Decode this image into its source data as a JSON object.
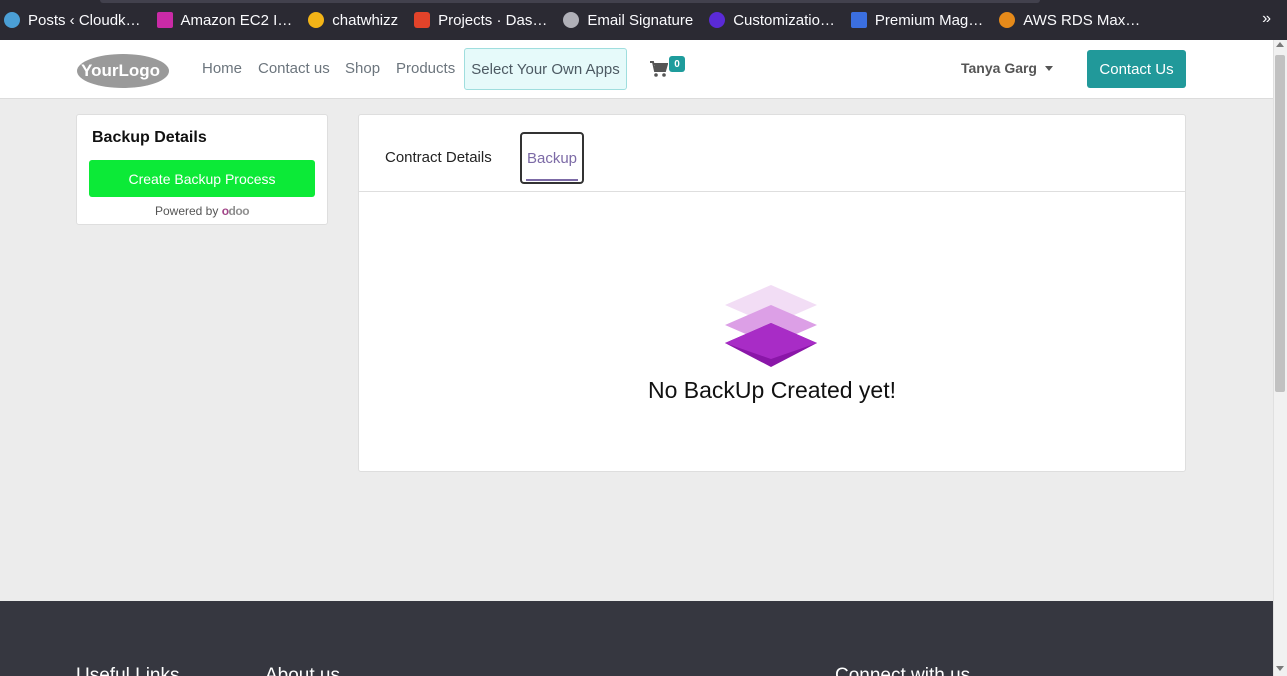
{
  "bookmarks": {
    "items": [
      {
        "label": "Posts ‹ Cloudk…",
        "icon": "wordpress-icon",
        "color": "#4b9fd6"
      },
      {
        "label": "Amazon EC2 I…",
        "icon": "ec2-icon",
        "color": "#c92aa6"
      },
      {
        "label": "chatwhizz",
        "icon": "chatwhizz-icon",
        "color": "#f3b417"
      },
      {
        "label": "Projects · Das…",
        "icon": "gitlab-icon",
        "color": "#e2432a"
      },
      {
        "label": "Email Signature",
        "icon": "globe-icon",
        "color": "#b0b0b8"
      },
      {
        "label": "Customizatio…",
        "icon": "customization-icon",
        "color": "#5a2ad6"
      },
      {
        "label": "Premium Mag…",
        "icon": "magento-icon",
        "color": "#3b6fe0"
      },
      {
        "label": "AWS RDS Max…",
        "icon": "aws-gear-icon",
        "color": "#e68a1a"
      }
    ],
    "more": "»"
  },
  "navbar": {
    "logo_text": "YourLogo",
    "links": [
      "Home",
      "Contact us",
      "Shop",
      "Products"
    ],
    "apps_button": "Select Your Own Apps",
    "cart_count": "0",
    "user_name": "Tanya Garg",
    "contact_button": "Contact Us"
  },
  "sidebar": {
    "title": "Backup Details",
    "create_button": "Create Backup Process",
    "powered_by": "Powered by",
    "odoo_first": "o",
    "odoo_rest": "doo"
  },
  "main": {
    "tabs": [
      {
        "label": "Contract Details",
        "active": false
      },
      {
        "label": "Backup",
        "active": true
      }
    ],
    "empty_message": "No BackUp Created yet!"
  },
  "footer": {
    "headings": [
      "Useful Links",
      "About us",
      "Connect with us"
    ]
  },
  "colors": {
    "accent": "#21999a",
    "create_button": "#0cea37",
    "active_tab": "#7c6aa6",
    "footer_bg": "#363740"
  }
}
